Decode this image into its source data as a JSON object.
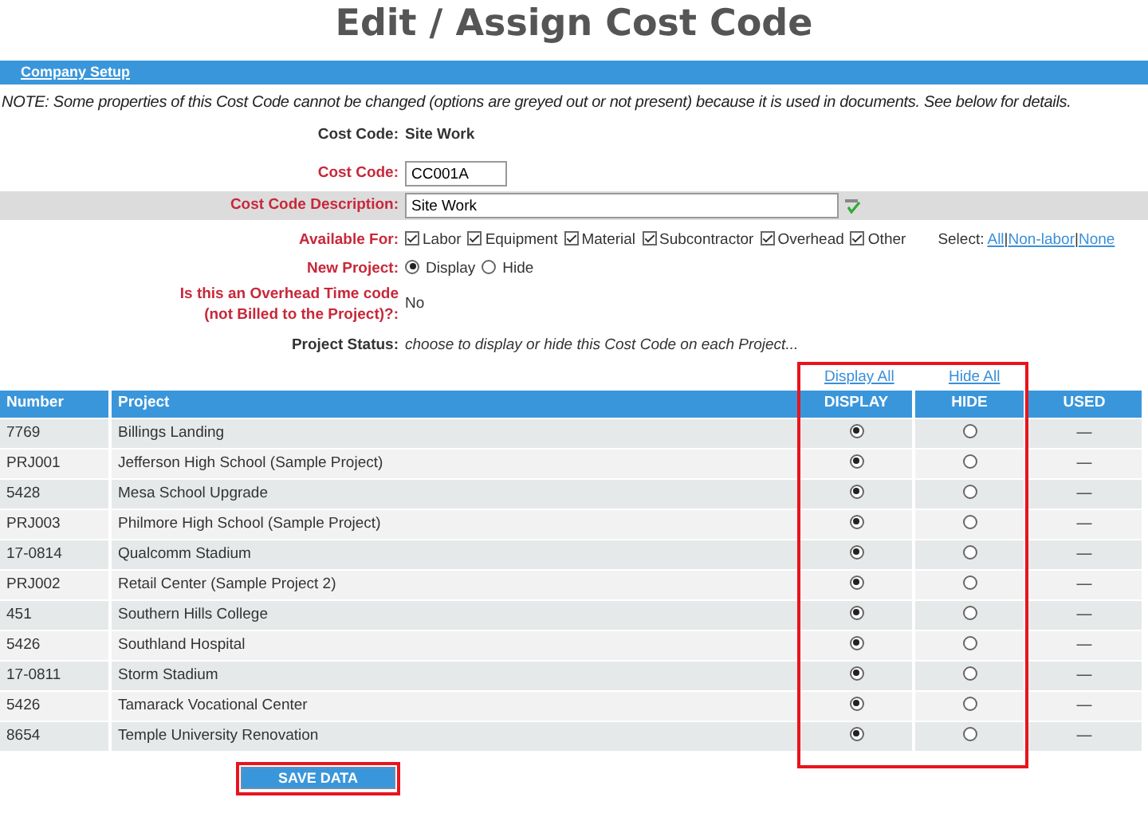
{
  "title": "Edit / Assign Cost Code",
  "breadcrumb": {
    "label": "Company Setup"
  },
  "note": "NOTE: Some properties of this Cost Code cannot be changed (options are greyed out or not present) because it is used in documents. See below for details.",
  "cost_code_name": {
    "label": "Cost Code:",
    "value": "Site Work"
  },
  "cost_code": {
    "label": "Cost Code:",
    "value": "CC001A"
  },
  "description": {
    "label": "Cost Code Description:",
    "value": "Site Work"
  },
  "available_for": {
    "label": "Available For:",
    "options": [
      {
        "label": "Labor",
        "checked": true
      },
      {
        "label": "Equipment",
        "checked": true
      },
      {
        "label": "Material",
        "checked": true
      },
      {
        "label": "Subcontractor",
        "checked": true
      },
      {
        "label": "Overhead",
        "checked": true
      },
      {
        "label": "Other",
        "checked": true
      }
    ],
    "select_label": "Select:",
    "select_links": [
      "All",
      "Non-labor",
      "None"
    ],
    "select_separator": "|"
  },
  "new_project": {
    "label": "New Project:",
    "options": [
      {
        "label": "Display",
        "selected": true
      },
      {
        "label": "Hide",
        "selected": false
      }
    ]
  },
  "overhead": {
    "label_lines": [
      "Is this an Overhead Time code",
      "(not Billed to the Project)?:"
    ],
    "value": "No"
  },
  "project_status": {
    "label": "Project Status:",
    "hint": "choose to display or hide this Cost Code on each Project..."
  },
  "table_links": [
    "Display All",
    "Hide All"
  ],
  "table": {
    "columns": [
      "Number",
      "Project",
      "DISPLAY",
      "HIDE",
      "USED"
    ],
    "rows": [
      {
        "number": "7769",
        "project": "Billings Landing",
        "display": true,
        "hide": false,
        "used": "—"
      },
      {
        "number": "PRJ001",
        "project": "Jefferson High School (Sample Project)",
        "display": true,
        "hide": false,
        "used": "—"
      },
      {
        "number": "5428",
        "project": "Mesa School Upgrade",
        "display": true,
        "hide": false,
        "used": "—"
      },
      {
        "number": "PRJ003",
        "project": "Philmore High School (Sample Project)",
        "display": true,
        "hide": false,
        "used": "—"
      },
      {
        "number": "17-0814",
        "project": "Qualcomm Stadium",
        "display": true,
        "hide": false,
        "used": "—"
      },
      {
        "number": "PRJ002",
        "project": "Retail Center (Sample Project 2)",
        "display": true,
        "hide": false,
        "used": "—"
      },
      {
        "number": "451",
        "project": "Southern Hills College",
        "display": true,
        "hide": false,
        "used": "—"
      },
      {
        "number": "5426",
        "project": "Southland Hospital",
        "display": true,
        "hide": false,
        "used": "—"
      },
      {
        "number": "17-0811",
        "project": "Storm Stadium",
        "display": true,
        "hide": false,
        "used": "—"
      },
      {
        "number": "5426",
        "project": "Tamarack Vocational Center",
        "display": true,
        "hide": false,
        "used": "—"
      },
      {
        "number": "8654",
        "project": "Temple University Renovation",
        "display": true,
        "hide": false,
        "used": "—"
      }
    ]
  },
  "save_button": "SAVE DATA"
}
